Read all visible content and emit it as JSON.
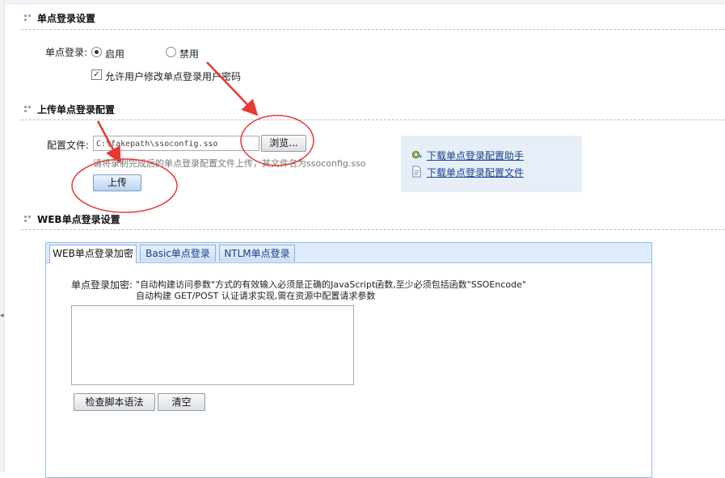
{
  "section_sso": {
    "title": "单点登录设置"
  },
  "sso": {
    "label": "单点登录:",
    "options": [
      {
        "label": "启用",
        "checked": true
      },
      {
        "label": "禁用",
        "checked": false
      }
    ],
    "allow_change": {
      "label": "允许用户修改单点登录用户密码",
      "checked": true
    }
  },
  "section_upload": {
    "title": "上传单点登录配置"
  },
  "upload": {
    "file_label": "配置文件:",
    "file_value": "C:\\fakepath\\ssoconfig.sso",
    "browse_label": "浏览...",
    "hint": "请将录制完成后的单点登录配置文件上传，其文件名为ssoconfig.sso",
    "upload_label": "上传"
  },
  "downloads": {
    "items": [
      {
        "label": "下载单点登录配置助手",
        "icon": "gear-download-icon"
      },
      {
        "label": "下载单点登录配置文件",
        "icon": "document-icon"
      }
    ]
  },
  "section_web": {
    "title": "WEB单点登录设置"
  },
  "tabs": [
    {
      "label": "WEB单点登录加密",
      "active": true
    },
    {
      "label": "Basic单点登录",
      "active": false
    },
    {
      "label": "NTLM单点登录",
      "active": false
    }
  ],
  "web": {
    "enc_label": "单点登录加密:",
    "desc1": "\"自动构建访问参数\"方式的有效输入必须是正确的JavaScript函数,至少必须包括函数\"SSOEncode\"",
    "desc2": "自动构建 GET/POST 认证请求实现,需在资源中配置请求参数",
    "script_value": "",
    "check_label": "检查脚本语法",
    "clear_label": "清空"
  },
  "colors": {
    "accent": "#15428b",
    "annotation": "#e53935"
  }
}
